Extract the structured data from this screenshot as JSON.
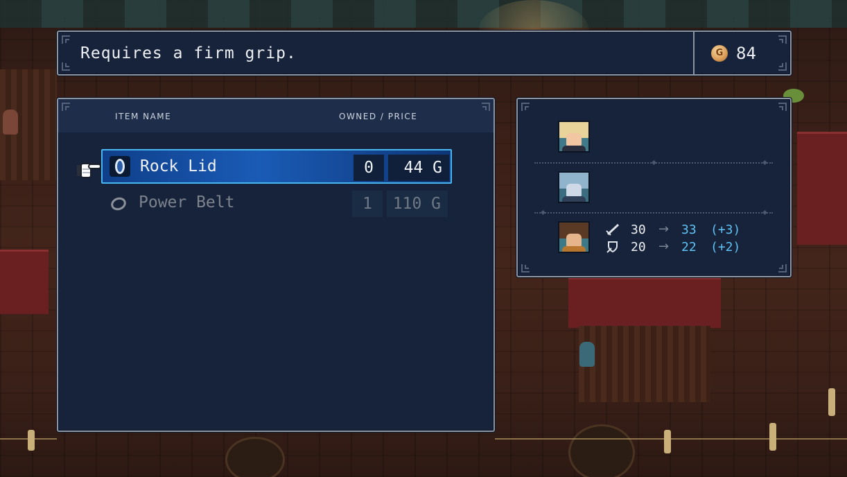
{
  "description": "Requires a firm grip.",
  "gold": {
    "coin_symbol": "G",
    "amount": "84"
  },
  "list_header": {
    "item_name": "ITEM NAME",
    "owned_price": "OWNED / PRICE"
  },
  "items": [
    {
      "name": "Rock Lid",
      "owned": "0",
      "price": "44 G",
      "icon": "shield-icon",
      "selected": true
    },
    {
      "name": "Power Belt",
      "owned": "1",
      "price": "110 G",
      "icon": "belt-icon",
      "selected": false
    }
  ],
  "party": [
    {
      "portrait": "blonde-hero-portrait",
      "can_equip": false
    },
    {
      "portrait": "blue-hair-hero-portrait",
      "can_equip": false
    },
    {
      "portrait": "brown-hair-hero-portrait",
      "can_equip": true,
      "stats": [
        {
          "icon": "sword-icon",
          "current": "30",
          "arrow": "→",
          "new": "33",
          "delta": "(+3)"
        },
        {
          "icon": "shield-stat-icon",
          "current": "20",
          "arrow": "→",
          "new": "22",
          "delta": "(+2)"
        }
      ]
    }
  ],
  "colors": {
    "panel_bg": "#17233a",
    "selection_border": "#49b6f2",
    "stat_increase": "#5fc3f5"
  }
}
